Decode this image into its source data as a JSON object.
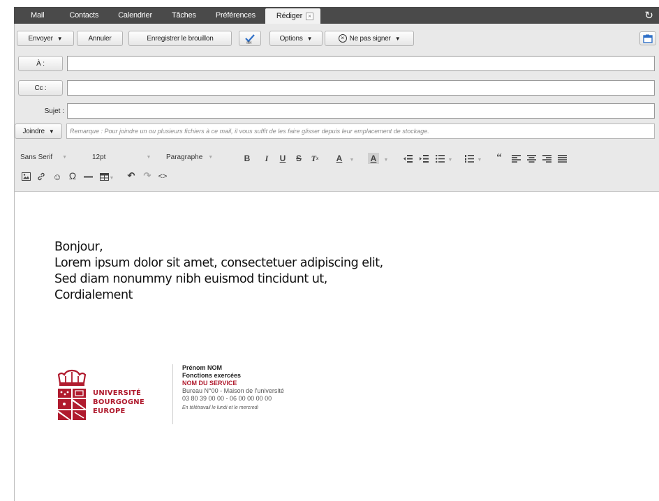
{
  "nav": {
    "tabs": [
      "Mail",
      "Contacts",
      "Calendrier",
      "Tâches",
      "Préférences"
    ],
    "active_tab": "Rédiger"
  },
  "toolbar": {
    "send": "Envoyer",
    "cancel": "Annuler",
    "save_draft": "Enregistrer le brouillon",
    "options": "Options",
    "sign": "Ne pas signer"
  },
  "fields": {
    "to_label": "À :",
    "cc_label": "Cc :",
    "subject_label": "Sujet :",
    "attach_label": "Joindre",
    "attach_note": "Remarque : Pour joindre un ou plusieurs fichiers à ce mail, il vous suffit de les faire glisser depuis leur emplacement de stockage.",
    "to_value": "",
    "cc_value": "",
    "subject_value": ""
  },
  "editor_toolbar": {
    "font_family": "Sans Serif",
    "font_size": "12pt",
    "block_format": "Paragraphe"
  },
  "message": {
    "lines": [
      "Bonjour,",
      "Lorem ipsum dolor sit amet, consectetuer adipiscing elit,",
      "Sed diam nonummy nibh euismod tincidunt ut,",
      "Cordialement"
    ]
  },
  "signature": {
    "logo_lines": [
      "UNIVERSITÉ",
      "BOURGOGNE",
      "EUROPE"
    ],
    "name": "Prénom NOM",
    "role": "Fonctions exercées",
    "service": "NOM DU SERVICE",
    "office": "Bureau N°00 - Maison de l'université",
    "phones": "03 80 39 00 00 - 06 00 00 00 00",
    "remote": "En télétravail le lundi et le mercredi"
  },
  "colors": {
    "brand_red": "#b01b2e",
    "nav_bg": "#4a4a4a"
  }
}
